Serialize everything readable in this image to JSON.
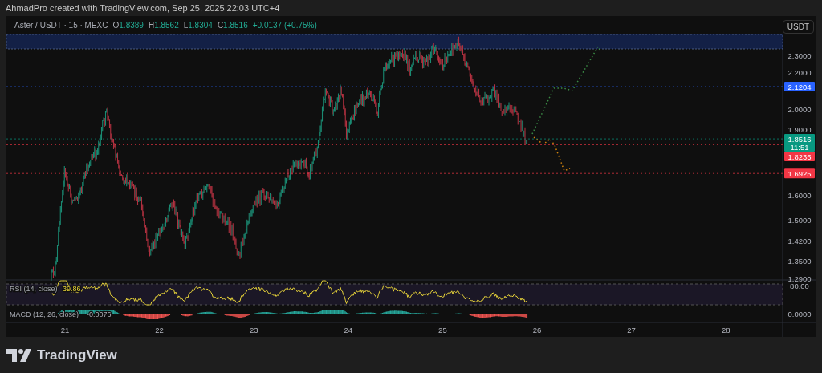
{
  "header": {
    "attribution": "AhmadPro created with TradingView.com, Sep 25, 2025 22:03 UTC+4"
  },
  "legend": {
    "symbol": "Aster / USDT · 15 · MEXC",
    "ohlc": [
      {
        "label": "O",
        "value": "1.8389"
      },
      {
        "label": "H",
        "value": "1.8562"
      },
      {
        "label": "L",
        "value": "1.8304"
      },
      {
        "label": "C",
        "value": "1.8516"
      }
    ],
    "change": "+0.0137 (+0.75%)"
  },
  "currency_button": "USDT",
  "price_axis": {
    "ticks": [
      "2.3000",
      "2.2000",
      "2.0000",
      "1.9000",
      "1.6000",
      "1.5000",
      "1.4200",
      "1.3500",
      "1.2900"
    ]
  },
  "price_tags": [
    {
      "text": "2.1204",
      "color": "#2962ff"
    },
    {
      "text": "1.8516",
      "time": "11:51",
      "color": "#089981"
    },
    {
      "text": "1.8235",
      "color": "#f23645"
    },
    {
      "text": "1.6925",
      "color": "#f23645"
    }
  ],
  "rsi": {
    "label": "RSI (14, close)",
    "value": "39.86",
    "axis_label": "80.00"
  },
  "macd": {
    "label": "MACD (12, 26, close)",
    "value": "-0.0076",
    "axis_label": "0.0000"
  },
  "time_axis": [
    "21",
    "22",
    "23",
    "24",
    "25",
    "26",
    "27",
    "28"
  ],
  "logo": {
    "text": "TradingView"
  }
}
